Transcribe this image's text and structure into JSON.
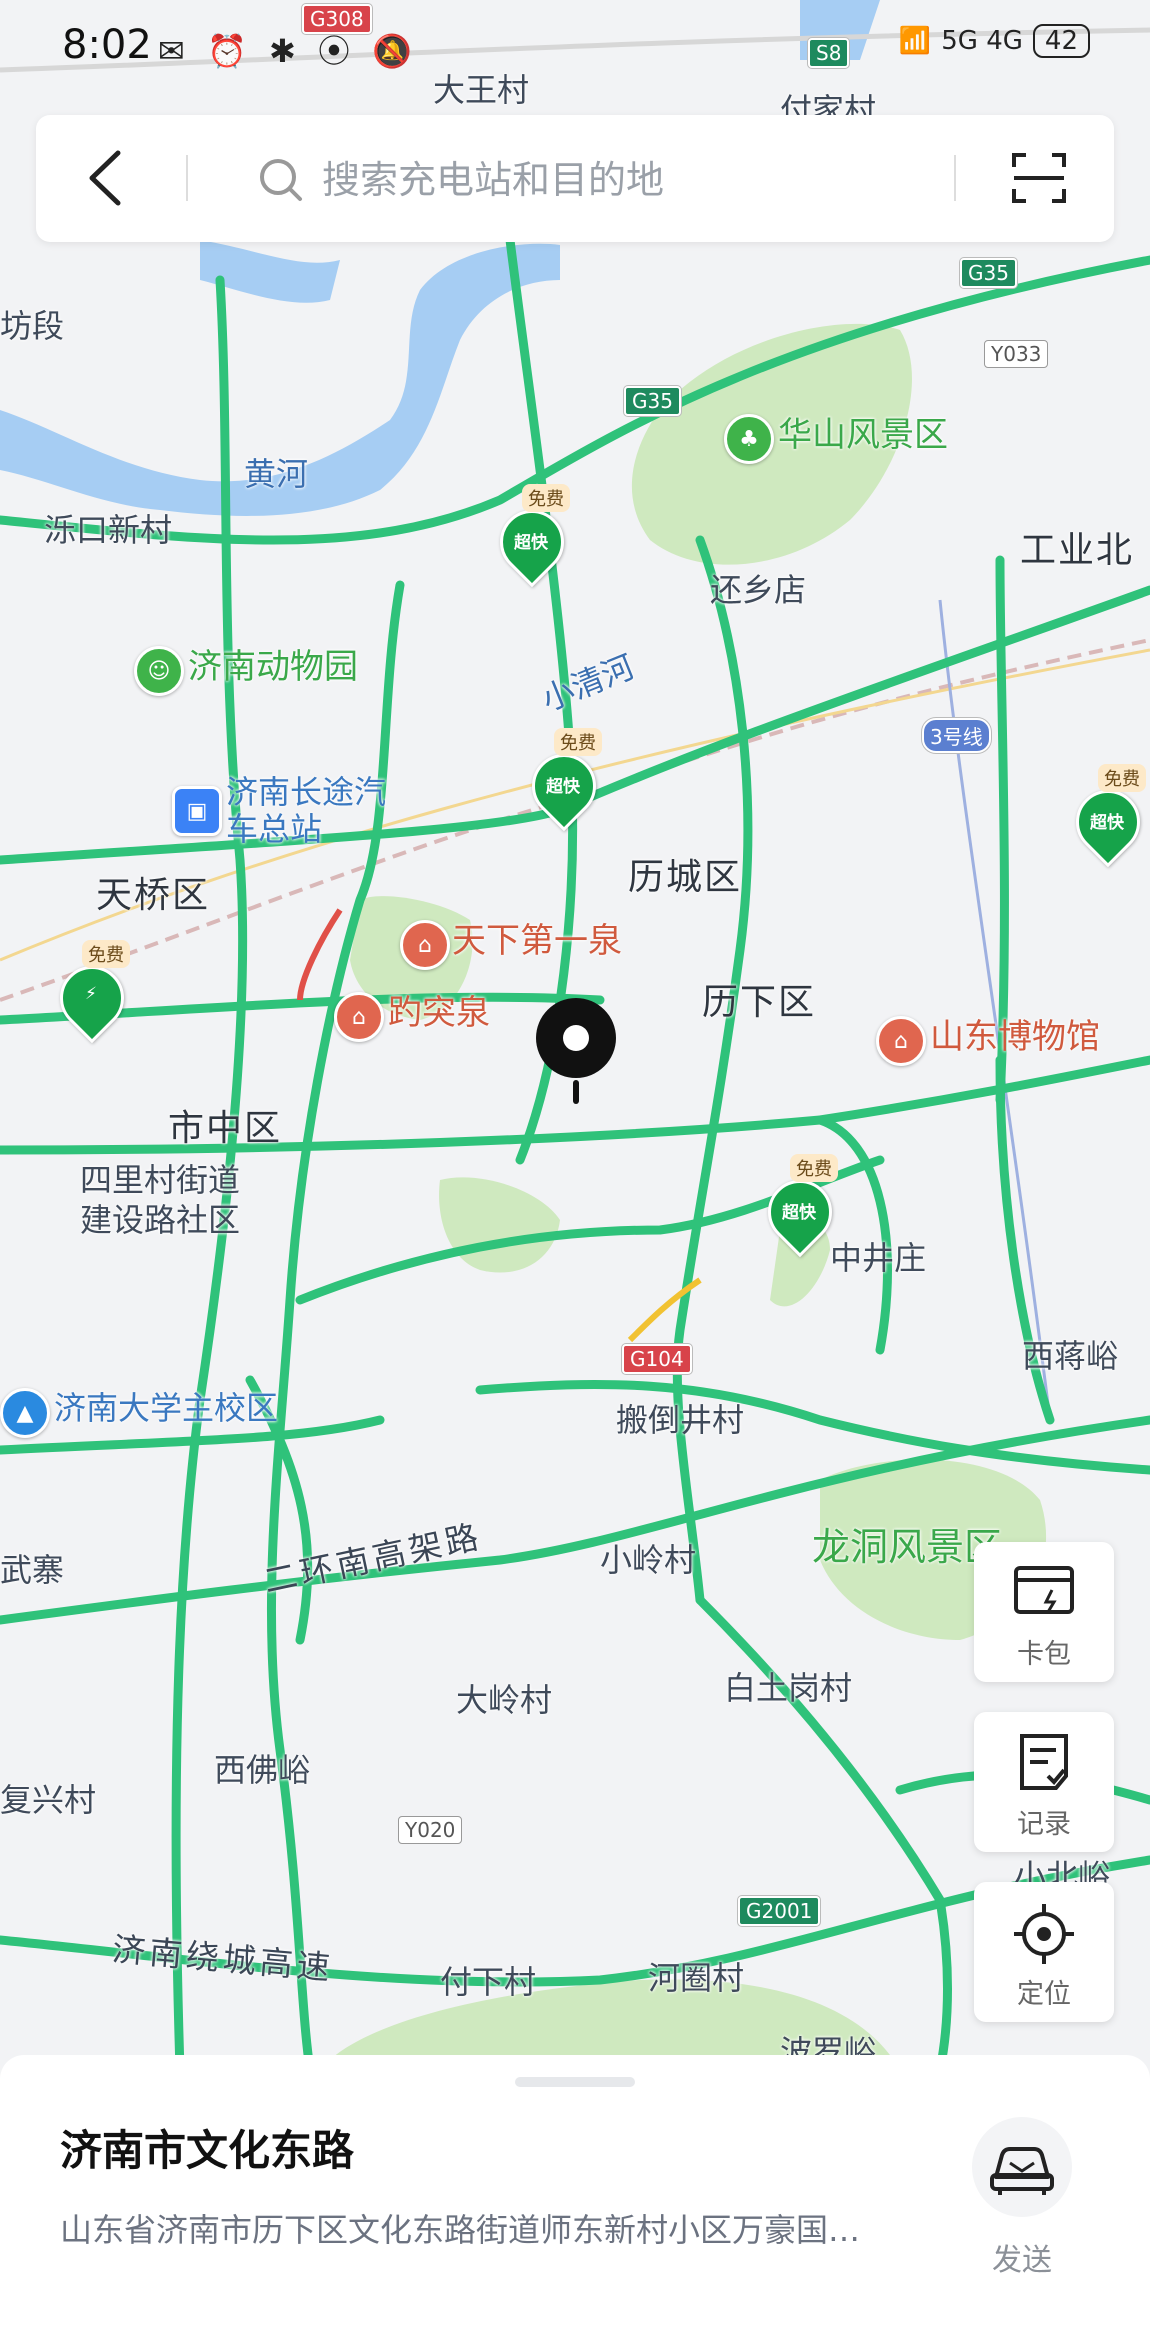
{
  "status_bar": {
    "time": "8:02",
    "network_label": "5G 4G",
    "battery": "42"
  },
  "search": {
    "placeholder": "搜索充电站和目的地"
  },
  "map": {
    "districts": [
      "天桥区",
      "历城区",
      "历下区",
      "市中区"
    ],
    "pois": {
      "huashan": "华山风景区",
      "zoo": "济南动物园",
      "bus_station": "济南长途汽车总站",
      "tianxia": "天下第一泉",
      "baotu": "趵突泉",
      "museum": "山东博物馆",
      "university": "济南大学主校区",
      "longdong": "龙洞风景区"
    },
    "places": {
      "dawang": "大王村",
      "fujia": "付家村",
      "tuokou": "泺口新村",
      "huanxiang": "还乡店",
      "gongye": "工业北",
      "fangduan": "坊段",
      "sili": "四里村街道",
      "jianshe": "建设路社区",
      "zhongjing": "中井庄",
      "xijiang": "西蒋峪",
      "bandao": "搬倒井村",
      "xiaoling": "小岭村",
      "wuzhai": "武寨",
      "daling": "大岭村",
      "baitu": "白土岗村",
      "xifo": "西佛峪",
      "fuxing": "复兴村",
      "xiaobei": "小北峪",
      "fuxia": "付下村",
      "hequan": "河圈村",
      "boluo": "波罗峪"
    },
    "water": {
      "huanghe": "黄河",
      "xiaoqing": "小清河"
    },
    "roads": {
      "ring": "二环南高架路",
      "ringway": "济南绕城高速"
    },
    "shields": [
      "G308",
      "G35",
      "G35",
      "Y033",
      "G104",
      "Y020",
      "G2001",
      "S8"
    ],
    "metro": "3号线",
    "charger_tag": "免费",
    "charger_label": "超快"
  },
  "fabs": {
    "card_pack": "卡包",
    "records": "记录",
    "locate": "定位"
  },
  "location_card": {
    "title": "济南市文化东路",
    "address": "山东省济南市历下区文化东路街道师东新村小区万豪国…",
    "send_label": "发送"
  },
  "colors": {
    "road_green": "#2fc27a",
    "park_green": "#cfe9bf",
    "water_blue": "#a6cdf3",
    "charger_green": "#16a34a"
  }
}
